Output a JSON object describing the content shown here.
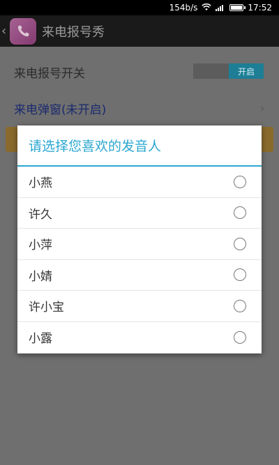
{
  "status_bar": {
    "network_speed": "154b/s",
    "time": "17:52",
    "wifi_icon": "wifi-icon",
    "signal_icon": "signal-icon",
    "battery_icon": "battery-icon"
  },
  "action_bar": {
    "back_icon": "chevron-left-icon",
    "app_icon": "phone-icon",
    "title": "来电报号秀"
  },
  "settings": {
    "switch_label": "来电报号开关",
    "switch_on_label": "开启",
    "popup_label": "来电弹窗(未开启)"
  },
  "dialog": {
    "title": "请选择您喜欢的发音人",
    "options": [
      {
        "label": "小燕",
        "selected": false
      },
      {
        "label": "许久",
        "selected": false
      },
      {
        "label": "小萍",
        "selected": false
      },
      {
        "label": "小婧",
        "selected": false
      },
      {
        "label": "许小宝",
        "selected": false
      },
      {
        "label": "小露",
        "selected": false
      }
    ]
  },
  "colors": {
    "accent": "#2aa7d1",
    "toggle_on": "#1d7e95"
  }
}
